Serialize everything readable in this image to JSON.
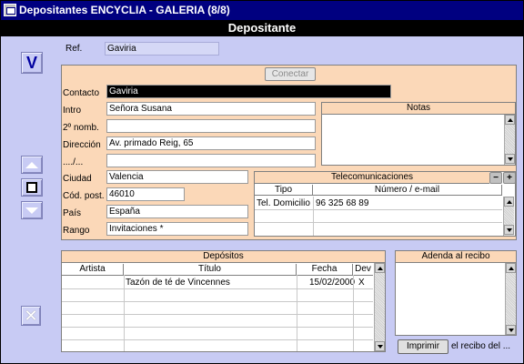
{
  "window": {
    "title": "Depositantes ENCYCLIA - GALERIA (8/8)"
  },
  "header": {
    "title": "Depositante"
  },
  "ref": {
    "label": "Ref.",
    "value": "Gaviria"
  },
  "form": {
    "conectar_label": "Conectar",
    "contacto": {
      "label": "Contacto",
      "value": "Gaviria"
    },
    "intro": {
      "label": "Intro",
      "value": "Señora Susana"
    },
    "nomb2": {
      "label": "2º nomb.",
      "value": ""
    },
    "direccion": {
      "label": "Dirección",
      "value": "Av. primado Reig, 65"
    },
    "direccion2": {
      "label": "..../...",
      "value": ""
    },
    "ciudad": {
      "label": "Ciudad",
      "value": "Valencia"
    },
    "cod_post": {
      "label": "Cód. post.",
      "value": "46010"
    },
    "pais": {
      "label": "País",
      "value": "España"
    },
    "rango": {
      "label": "Rango",
      "value": "Invitaciones *"
    }
  },
  "notas": {
    "title": "Notas"
  },
  "telecom": {
    "title": "Telecomunicaciones",
    "col_tipo": "Tipo",
    "col_numero": "Número / e-mail",
    "rows": [
      {
        "tipo": "Tel. Domicilio",
        "numero": "96 325 68 89"
      }
    ]
  },
  "depositos": {
    "title": "Depósitos",
    "columns": [
      "Artista",
      "Título",
      "Fecha",
      "Dev"
    ],
    "rows": [
      {
        "artista": "",
        "titulo": "Tazón de té de Vincennes",
        "fecha": "15/02/2000",
        "dev": "X"
      }
    ]
  },
  "adenda": {
    "title": "Adenda al recibo",
    "imprimir_label": "Imprimir",
    "recibo_text": "el recibo del ..."
  },
  "nav": {
    "v_label": "V"
  }
}
